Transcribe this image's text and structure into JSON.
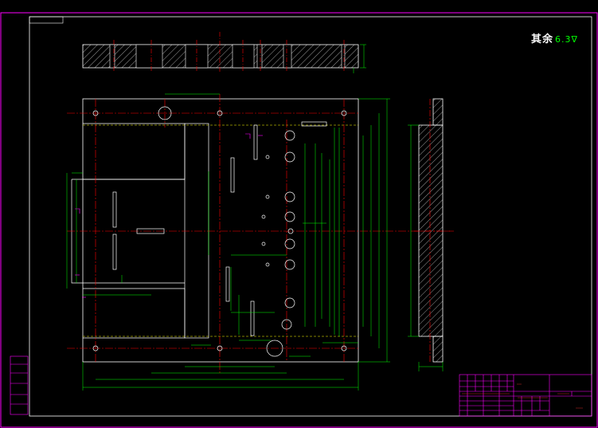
{
  "roughness_note": "其余",
  "roughness_symbol": "6.3",
  "colors": {
    "background": "#000000",
    "border": "#ff00ff",
    "outline": "#ffffff",
    "centerline": "#ff0000",
    "dimension": "#00ff00",
    "hatch": "#ffffff"
  },
  "icons": [
    "roughness-symbol-icon"
  ]
}
